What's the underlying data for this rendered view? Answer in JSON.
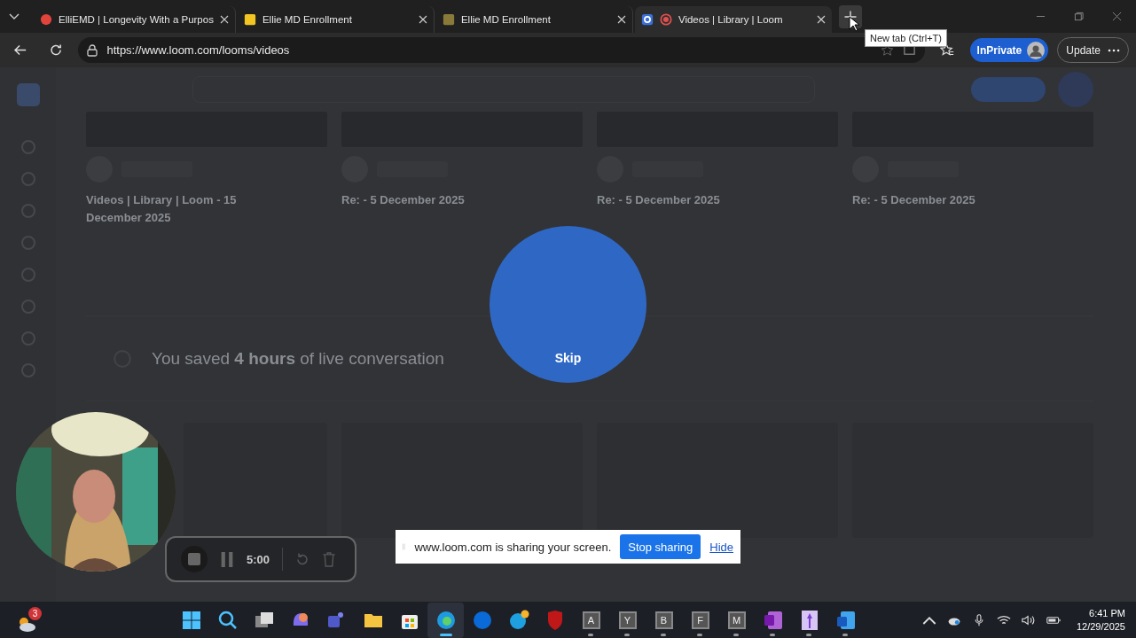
{
  "tabs": [
    {
      "title": "ElliEMD | Longevity With a Purpos",
      "kind": "dot",
      "color": "#e0443a",
      "selected": false
    },
    {
      "title": "Ellie MD Enrollment",
      "kind": "square",
      "color": "#f2c522",
      "selected": false
    },
    {
      "title": "Ellie MD Enrollment",
      "kind": "square",
      "color": "#8a7a3a",
      "selected": false
    },
    {
      "title": "Videos | Library | Loom",
      "kind": "record",
      "color": "#e05050",
      "selected": true
    }
  ],
  "tooltip": "New tab (Ctrl+T)",
  "address": {
    "url": "https://www.loom.com/looms/videos"
  },
  "inprivate": "InPrivate",
  "update": "Update",
  "cards": [
    {
      "title": "Videos | Library | Loom - 15 December 2025"
    },
    {
      "title": "Re: - 5 December 2025"
    },
    {
      "title": "Re: - 5 December 2025"
    },
    {
      "title": "Re: - 5 December 2025"
    }
  ],
  "banner": {
    "text": "You saved **4 hours** of live conversation"
  },
  "skip": "Skip",
  "recorder": {
    "time": "5:00"
  },
  "share": {
    "message": "www.loom.com is sharing your screen.",
    "stop": "Stop sharing",
    "hide": "Hide"
  },
  "weather_badge": "3",
  "taskbar": [
    {
      "kind": "windows",
      "running": false,
      "selected": false
    },
    {
      "kind": "search",
      "running": false,
      "selected": false
    },
    {
      "kind": "taskview",
      "running": false,
      "selected": false
    },
    {
      "kind": "copilot",
      "running": false,
      "selected": false
    },
    {
      "kind": "teams",
      "running": false,
      "selected": false
    },
    {
      "kind": "folder",
      "running": false,
      "selected": false
    },
    {
      "kind": "store",
      "running": false,
      "selected": false
    },
    {
      "kind": "edge",
      "running": true,
      "selected": true
    },
    {
      "kind": "hp",
      "running": false,
      "selected": false
    },
    {
      "kind": "chat",
      "running": false,
      "selected": false
    },
    {
      "kind": "shield",
      "running": false,
      "selected": false
    },
    {
      "kind": "letter",
      "label": "A",
      "running": true,
      "selected": false
    },
    {
      "kind": "letter",
      "label": "Y",
      "running": true,
      "selected": false
    },
    {
      "kind": "letter",
      "label": "B",
      "running": true,
      "selected": false
    },
    {
      "kind": "letter",
      "label": "F",
      "running": true,
      "selected": false
    },
    {
      "kind": "letter",
      "label": "M",
      "running": true,
      "selected": false
    },
    {
      "kind": "onenote",
      "running": true,
      "selected": false
    },
    {
      "kind": "figure",
      "running": true,
      "selected": false
    },
    {
      "kind": "word",
      "running": true,
      "selected": false
    }
  ],
  "clock": {
    "time": "6:41 PM",
    "date": "12/29/2025"
  }
}
